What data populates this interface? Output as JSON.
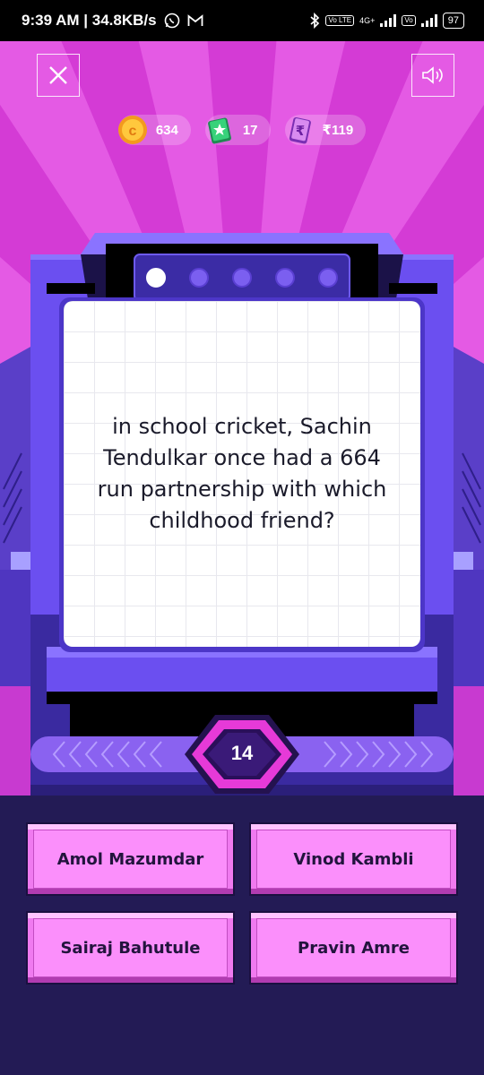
{
  "status_bar": {
    "time_speed": "9:39 AM | 34.8KB/s",
    "network": "4G+",
    "volte": "Vo LTE",
    "battery": "97"
  },
  "header": {
    "close_icon": "close-icon",
    "sound_icon": "speaker-icon"
  },
  "currencies": [
    {
      "icon": "coin-icon",
      "value": "634",
      "color": "#f5a623"
    },
    {
      "icon": "ticket-icon",
      "value": "17",
      "color": "#2ecc71"
    },
    {
      "icon": "rupee-note-icon",
      "value": "₹119",
      "color": "#b04fd8"
    }
  ],
  "progress": {
    "total_questions": 5,
    "current_index": 1
  },
  "question": {
    "text": "in school cricket, Sachin Tendulkar once had a 664 run partnership with which childhood friend?"
  },
  "timer": {
    "seconds": "14"
  },
  "answers": [
    {
      "label": "Amol Mazumdar"
    },
    {
      "label": "Vinod Kambli"
    },
    {
      "label": "Sairaj Bahutule"
    },
    {
      "label": "Pravin Amre"
    }
  ],
  "colors": {
    "background_magenta": "#d63bd6",
    "machine_purple": "#6a4fe8",
    "answer_pink": "#fb8ffb",
    "bottom_navy": "#231b55"
  }
}
